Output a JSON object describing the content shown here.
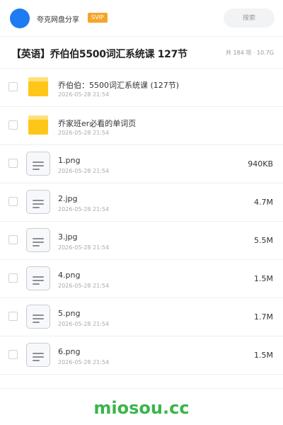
{
  "header": {
    "title": "夸克网盘分享",
    "badge": "SVIP",
    "search_placeholder": "搜索"
  },
  "folder": {
    "title": "【英语】乔伯伯5500词汇系统课 127节",
    "count": "共 184 项",
    "separator": "·",
    "total_size": "10.7G"
  },
  "files": [
    {
      "type": "folder",
      "name": "乔伯伯：5500词汇系统课 (127节)",
      "date": "2026-05-28 21:54",
      "size": ""
    },
    {
      "type": "folder",
      "name": "乔家班er必看的单词页",
      "date": "2026-05-28 21:54",
      "size": ""
    },
    {
      "type": "file",
      "name": "1.png",
      "date": "2026-05-28 21:54",
      "size": "940KB"
    },
    {
      "type": "file",
      "name": "2.jpg",
      "date": "2026-05-28 21:54",
      "size": "4.7M"
    },
    {
      "type": "file",
      "name": "3.jpg",
      "date": "2026-05-28 21:54",
      "size": "5.5M"
    },
    {
      "type": "file",
      "name": "4.png",
      "date": "2026-05-28 21:54",
      "size": "1.5M"
    },
    {
      "type": "file",
      "name": "5.png",
      "date": "2026-05-28 21:54",
      "size": "1.7M"
    },
    {
      "type": "file",
      "name": "6.png",
      "date": "2026-05-28 21:54",
      "size": "1.5M"
    }
  ],
  "watermark": "miosou.cc",
  "colors": {
    "avatar": "#1e7bf2",
    "badge": "#f5a62a",
    "folder": "#ffc61a",
    "watermark": "#3ab54a"
  }
}
